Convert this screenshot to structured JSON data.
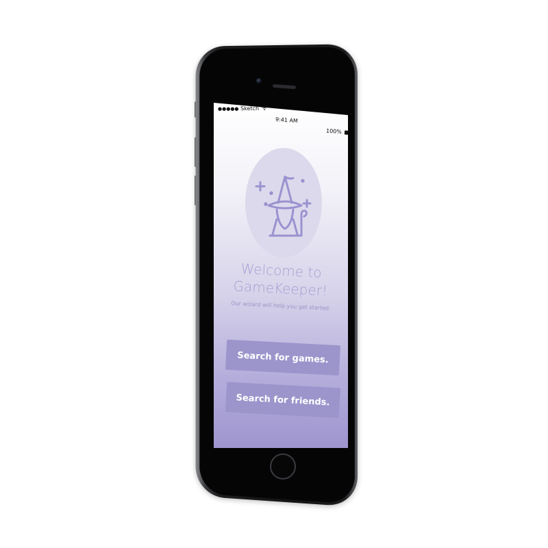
{
  "status_bar": {
    "signal": "●●●●●",
    "carrier": "Sketch",
    "wifi_icon": "wifi-icon",
    "time": "9:41 AM",
    "battery": "100%"
  },
  "welcome": {
    "title_line1": "Welcome to",
    "title_line2": "GameKeeper!",
    "subtitle": "Our wizard will help you get started."
  },
  "actions": {
    "search_games": "Search for games.",
    "search_friends": "Search for friends."
  },
  "icons": {
    "hero": "wizard-icon"
  },
  "colors": {
    "accent": "#9c95cc",
    "title_text": "#a59fd2",
    "icon_circle": "#dcd9ec",
    "gradient_bottom": "#9e95cf"
  }
}
